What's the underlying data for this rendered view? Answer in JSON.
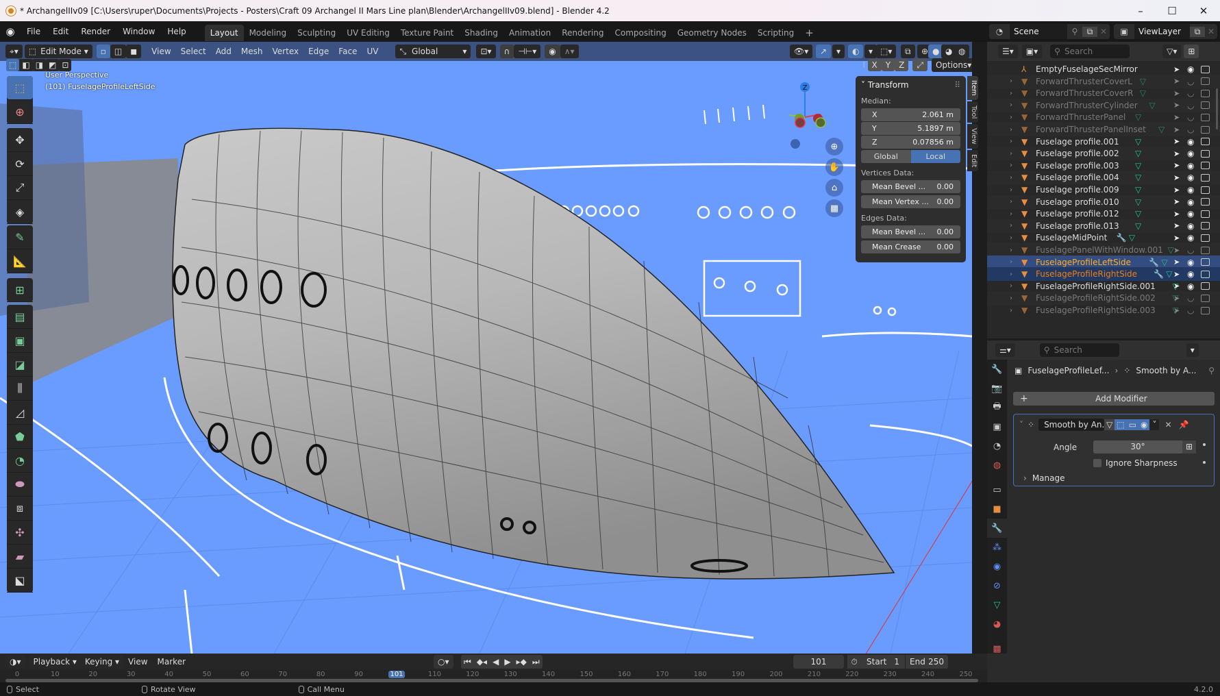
{
  "window": {
    "title": "* ArchangelIIv09 [C:\\Users\\ruper\\Documents\\Projects - Posters\\Craft 09 Archangel II Mars Line plan\\Blender\\ArchangelIIv09.blend] - Blender 4.2",
    "minimize": "–",
    "maximize": "☐",
    "close": "✕"
  },
  "menu": [
    "File",
    "Edit",
    "Render",
    "Window",
    "Help"
  ],
  "workspaces": [
    {
      "label": "Layout",
      "active": true
    },
    {
      "label": "Modeling"
    },
    {
      "label": "Sculpting"
    },
    {
      "label": "UV Editing"
    },
    {
      "label": "Texture Paint"
    },
    {
      "label": "Shading"
    },
    {
      "label": "Animation"
    },
    {
      "label": "Rendering"
    },
    {
      "label": "Compositing"
    },
    {
      "label": "Geometry Nodes"
    },
    {
      "label": "Scripting"
    }
  ],
  "add_workspace": "+",
  "scene": {
    "label": "Scene",
    "view_layer": "ViewLayer"
  },
  "viewport": {
    "mode": "Edit Mode",
    "menus": [
      "View",
      "Select",
      "Add",
      "Mesh",
      "Vertex",
      "Edge",
      "Face",
      "UV"
    ],
    "orientation": "Global",
    "perspective_label": "User Perspective",
    "object_label": "(101) FuselageProfileLeftSide",
    "options_label": "Options",
    "mirror_axes": [
      "X",
      "Y",
      "Z"
    ],
    "gizmo_axes": {
      "z": "Z",
      "x": "X",
      "y": "Y"
    }
  },
  "tools": [
    "select-box",
    "cursor",
    "move",
    "rotate",
    "scale",
    "transform",
    "annotate",
    "measure",
    "add-cube",
    "extrude",
    "inset",
    "bevel",
    "loop-cut",
    "knife",
    "poly-build",
    "spin",
    "smooth",
    "edge-slide",
    "shrink-fatten",
    "shear",
    "rip-region"
  ],
  "transform_panel": {
    "title": "Transform",
    "median_label": "Median:",
    "x": {
      "label": "X",
      "value": "2.061 m"
    },
    "y": {
      "label": "Y",
      "value": "5.1897 m"
    },
    "z": {
      "label": "Z",
      "value": "0.07856 m"
    },
    "space_global": "Global",
    "space_local": "Local",
    "vertices_label": "Vertices Data:",
    "vert_bevel": {
      "label": "Mean Bevel ...",
      "value": "0.00"
    },
    "vert_crease": {
      "label": "Mean Vertex ...",
      "value": "0.00"
    },
    "edges_label": "Edges Data:",
    "edge_bevel": {
      "label": "Mean Bevel ...",
      "value": "0.00"
    },
    "edge_crease": {
      "label": "Mean Crease",
      "value": "0.00"
    }
  },
  "npanel_tabs": [
    "Item",
    "Tool",
    "View",
    "Edit"
  ],
  "outliner": {
    "search_placeholder": "Search",
    "rows": [
      {
        "name": "EmptyFuselageSecMirror",
        "type": "empty",
        "dim": false,
        "visible": true
      },
      {
        "name": "ForwardThrusterCoverL",
        "type": "mesh",
        "dim": true,
        "visible": false
      },
      {
        "name": "ForwardThrusterCoverR",
        "type": "mesh",
        "dim": true,
        "visible": false
      },
      {
        "name": "ForwardThrusterCylinder",
        "type": "mesh",
        "dim": true,
        "visible": false
      },
      {
        "name": "ForwardThrusterPanel",
        "type": "mesh",
        "dim": true,
        "visible": false
      },
      {
        "name": "ForwardThrusterPanelInset",
        "type": "mesh",
        "dim": true,
        "visible": false
      },
      {
        "name": "Fuselage profile.001",
        "type": "mesh",
        "dim": false,
        "visible": true
      },
      {
        "name": "Fuselage profile.002",
        "type": "mesh",
        "dim": false,
        "visible": true
      },
      {
        "name": "Fuselage profile.003",
        "type": "mesh",
        "dim": false,
        "visible": true
      },
      {
        "name": "Fuselage profile.004",
        "type": "mesh",
        "dim": false,
        "visible": true
      },
      {
        "name": "Fuselage profile.009",
        "type": "mesh",
        "dim": false,
        "visible": true
      },
      {
        "name": "Fuselage profile.010",
        "type": "mesh",
        "dim": false,
        "visible": true
      },
      {
        "name": "Fuselage profile.012",
        "type": "mesh",
        "dim": false,
        "visible": true
      },
      {
        "name": "Fuselage profile.013",
        "type": "mesh",
        "dim": false,
        "visible": true
      },
      {
        "name": "FuselageMidPoint",
        "type": "mesh",
        "dim": false,
        "visible": true,
        "modifier": true
      },
      {
        "name": "FuselagePanelWithWindow.001",
        "type": "mesh",
        "dim": true,
        "visible": false
      },
      {
        "name": "FuselageProfileLeftSide",
        "type": "mesh",
        "dim": false,
        "visible": true,
        "modifier": true,
        "selected": "active"
      },
      {
        "name": "FuselageProfileRightSide",
        "type": "mesh",
        "dim": false,
        "visible": true,
        "modifier": true,
        "selected": "selected"
      },
      {
        "name": "FuselageProfileRightSide.001",
        "type": "mesh",
        "dim": false,
        "visible": true
      },
      {
        "name": "FuselageProfileRightSide.002",
        "type": "mesh",
        "dim": true,
        "visible": false
      },
      {
        "name": "FuselageProfileRightSide.003",
        "type": "mesh",
        "dim": true,
        "visible": false
      }
    ]
  },
  "properties": {
    "search_placeholder": "Search",
    "breadcrumb_object": "FuselageProfileLef...",
    "breadcrumb_modifier": "Smooth by A...",
    "add_modifier": "Add Modifier",
    "modifier": {
      "name": "Smooth by An...",
      "angle_label": "Angle",
      "angle_value": "30°",
      "ignore_sharpness_label": "Ignore Sharpness",
      "ignore_sharpness": false,
      "manage_label": "Manage"
    }
  },
  "timeline": {
    "menus": [
      "Playback",
      "Keying",
      "View",
      "Marker"
    ],
    "current_frame": "101",
    "start_label": "Start",
    "start": "1",
    "end_label": "End",
    "end": "250",
    "ticks": [
      "0",
      "10",
      "20",
      "30",
      "40",
      "50",
      "60",
      "70",
      "80",
      "90",
      "101",
      "110",
      "120",
      "130",
      "140",
      "150",
      "160",
      "170",
      "180",
      "190",
      "200",
      "210",
      "220",
      "230",
      "240",
      "250"
    ]
  },
  "statusbar": {
    "select": "Select",
    "rotate": "Rotate View",
    "call_menu": "Call Menu",
    "version": "4.2.0"
  },
  "colors": {
    "accent": "#4772b3",
    "viewport_bg": "#6a9bff",
    "active_object": "#ffaf29",
    "selected_object": "#ed7f15",
    "mesh_data": "#1fc39a"
  }
}
